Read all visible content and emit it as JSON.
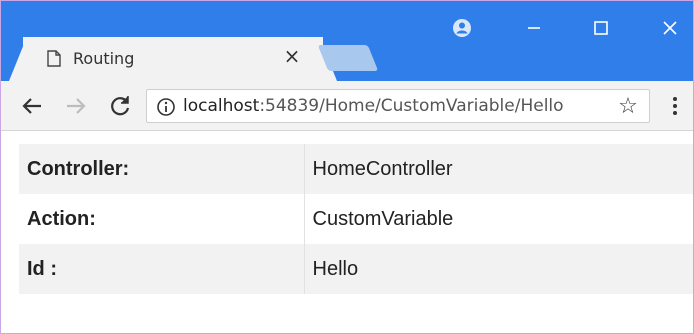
{
  "browser": {
    "tab_title": "Routing",
    "tab_close": "×",
    "url_host": "localhost",
    "url_rest": ":54839/Home/CustomVariable/Hello",
    "colors": {
      "titlebar": "#2f7ee9",
      "toolbar": "#f2f2f2"
    },
    "icons": {
      "tab": "document-icon",
      "close": "close-icon",
      "account": "account-icon",
      "minimize": "minimize-icon",
      "maximize": "maximize-icon",
      "window_close": "window-close-icon",
      "back": "back-arrow-icon",
      "forward": "forward-arrow-icon",
      "reload": "reload-icon",
      "info": "info-icon",
      "star": "star-icon",
      "menu": "kebab-menu-icon"
    }
  },
  "page": {
    "rows": [
      {
        "label": "Controller:",
        "value": "HomeController"
      },
      {
        "label": "Action:",
        "value": "CustomVariable"
      },
      {
        "label": "Id :",
        "value": "Hello"
      }
    ]
  }
}
